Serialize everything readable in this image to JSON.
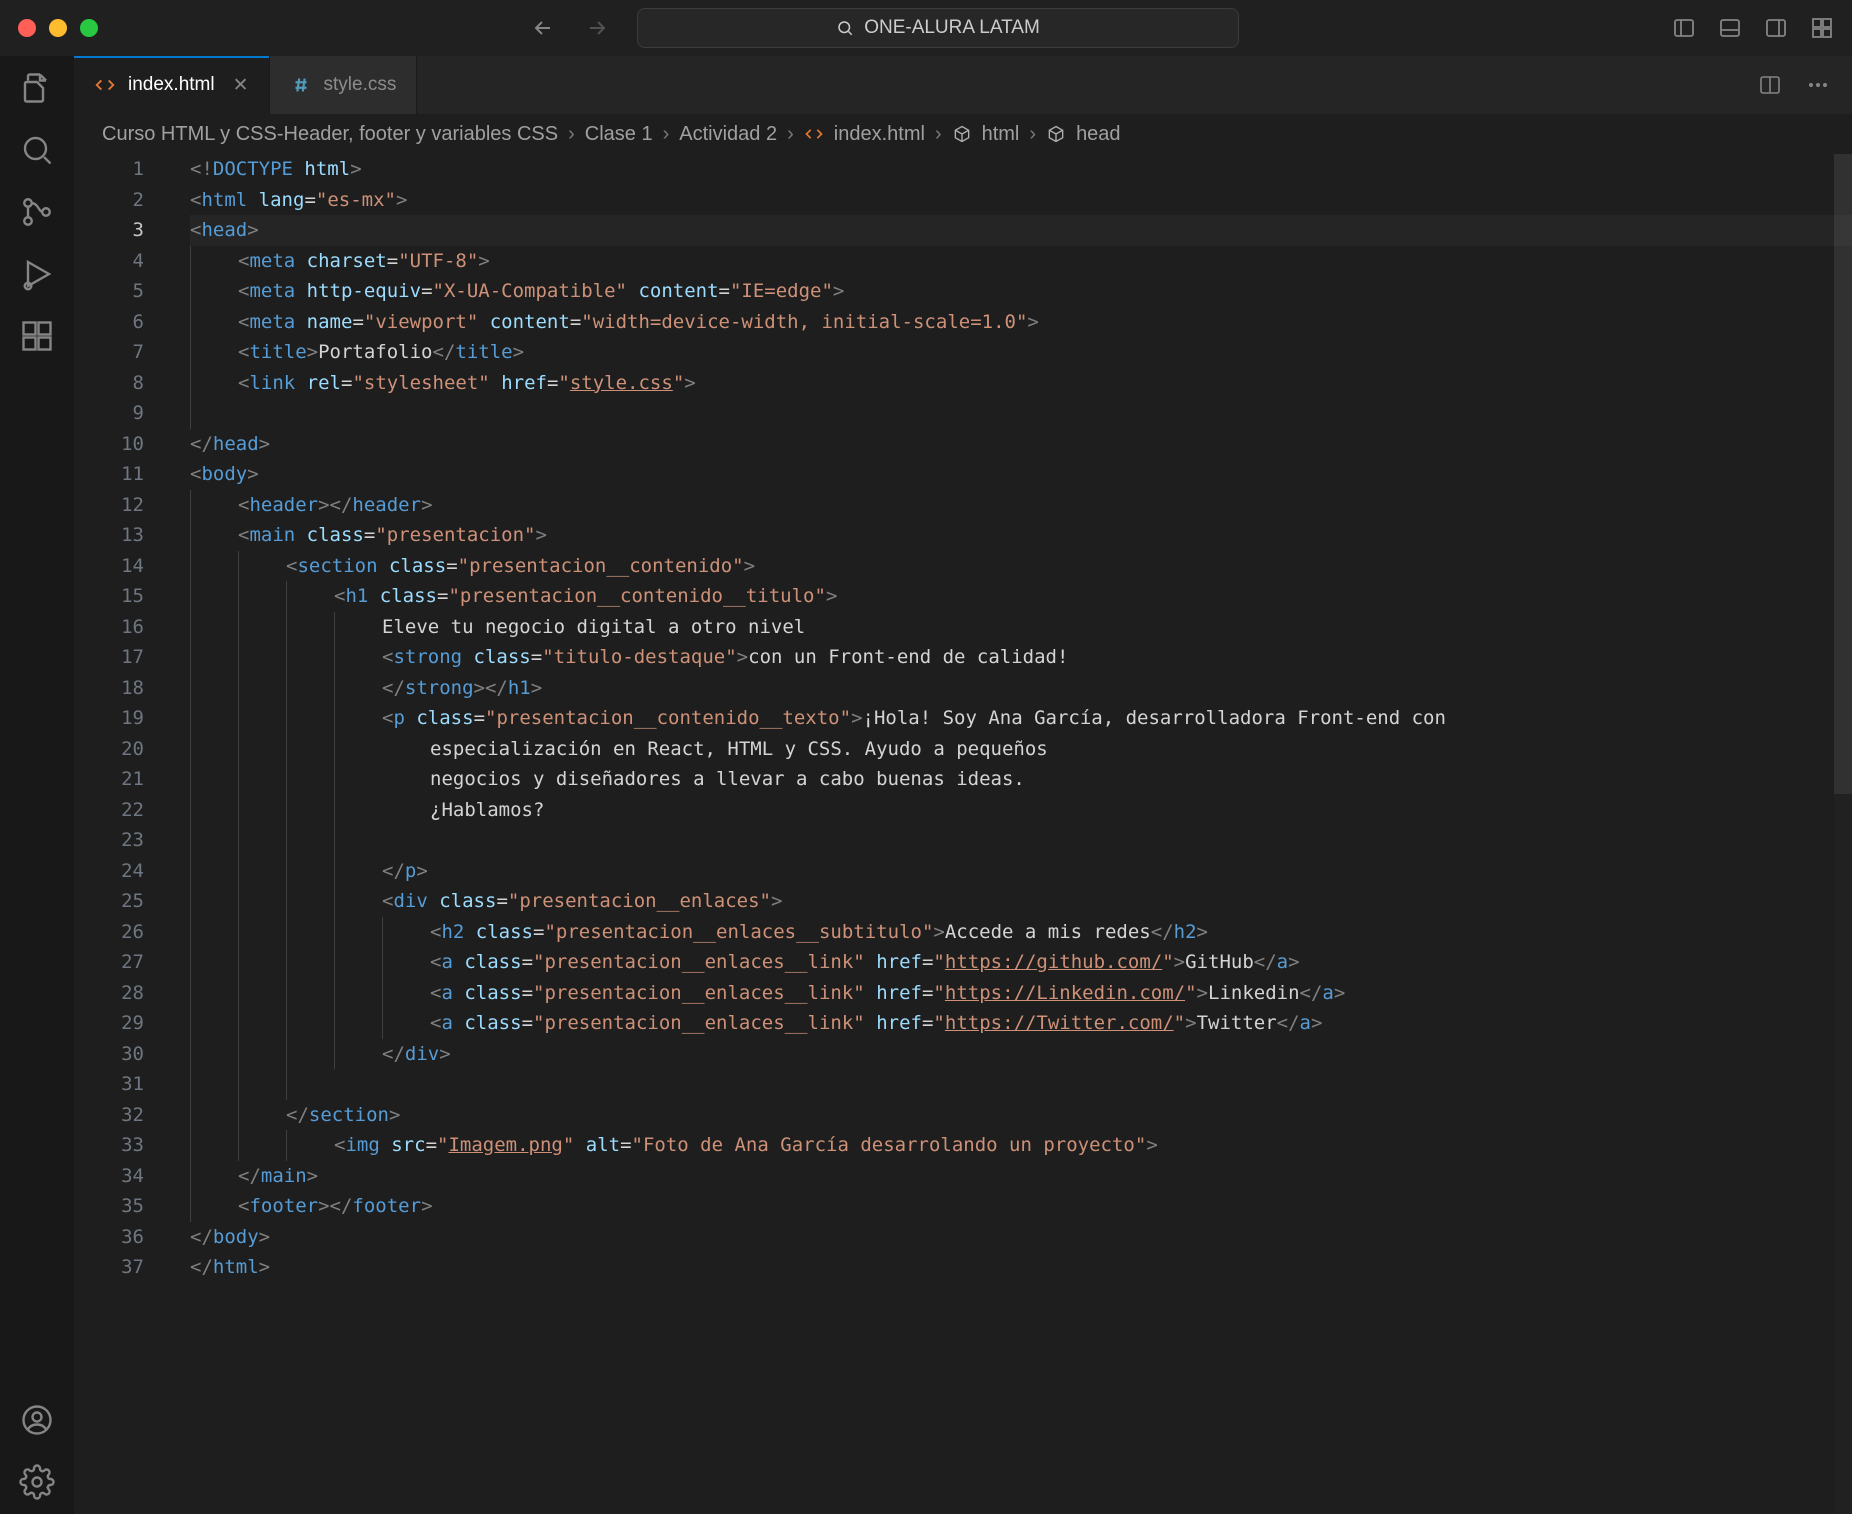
{
  "titlebar": {
    "workspace": "ONE-ALURA LATAM"
  },
  "tabs": [
    {
      "label": "index.html",
      "active": true,
      "kind": "html"
    },
    {
      "label": "style.css",
      "active": false,
      "kind": "css"
    }
  ],
  "breadcrumbs": [
    {
      "label": "Curso HTML y CSS-Header, footer y variables CSS",
      "icon": null
    },
    {
      "label": "Clase 1",
      "icon": null
    },
    {
      "label": "Actividad 2",
      "icon": null
    },
    {
      "label": "index.html",
      "icon": "code"
    },
    {
      "label": "html",
      "icon": "cube"
    },
    {
      "label": "head",
      "icon": "cube"
    }
  ],
  "active_line": 3,
  "line_count": 37,
  "code_tokens": [
    [
      [
        "t-gray",
        "<!"
      ],
      [
        "t-tag",
        "DOCTYPE"
      ],
      [
        "t-txt",
        " "
      ],
      [
        "t-attr",
        "html"
      ],
      [
        "t-gray",
        ">"
      ]
    ],
    [
      [
        "t-gray",
        "<"
      ],
      [
        "t-tag",
        "html"
      ],
      [
        "t-txt",
        " "
      ],
      [
        "t-attr",
        "lang"
      ],
      [
        "t-txt",
        "="
      ],
      [
        "t-str",
        "\"es-mx\""
      ],
      [
        "t-gray",
        ">"
      ]
    ],
    [
      [
        "t-gray",
        "<"
      ],
      [
        "t-tag",
        "head"
      ],
      [
        "t-gray",
        ">"
      ]
    ],
    [
      [
        "indent",
        1
      ],
      [
        "t-gray",
        "<"
      ],
      [
        "t-tag",
        "meta"
      ],
      [
        "t-txt",
        " "
      ],
      [
        "t-attr",
        "charset"
      ],
      [
        "t-txt",
        "="
      ],
      [
        "t-str",
        "\"UTF-8\""
      ],
      [
        "t-gray",
        ">"
      ]
    ],
    [
      [
        "indent",
        1
      ],
      [
        "t-gray",
        "<"
      ],
      [
        "t-tag",
        "meta"
      ],
      [
        "t-txt",
        " "
      ],
      [
        "t-attr",
        "http-equiv"
      ],
      [
        "t-txt",
        "="
      ],
      [
        "t-str",
        "\"X-UA-Compatible\""
      ],
      [
        "t-txt",
        " "
      ],
      [
        "t-attr",
        "content"
      ],
      [
        "t-txt",
        "="
      ],
      [
        "t-str",
        "\"IE=edge\""
      ],
      [
        "t-gray",
        ">"
      ]
    ],
    [
      [
        "indent",
        1
      ],
      [
        "t-gray",
        "<"
      ],
      [
        "t-tag",
        "meta"
      ],
      [
        "t-txt",
        " "
      ],
      [
        "t-attr",
        "name"
      ],
      [
        "t-txt",
        "="
      ],
      [
        "t-str",
        "\"viewport\""
      ],
      [
        "t-txt",
        " "
      ],
      [
        "t-attr",
        "content"
      ],
      [
        "t-txt",
        "="
      ],
      [
        "t-str",
        "\"width=device-width, initial-scale=1.0\""
      ],
      [
        "t-gray",
        ">"
      ]
    ],
    [
      [
        "indent",
        1
      ],
      [
        "t-gray",
        "<"
      ],
      [
        "t-tag",
        "title"
      ],
      [
        "t-gray",
        ">"
      ],
      [
        "t-txt",
        "Portafolio"
      ],
      [
        "t-gray",
        "</"
      ],
      [
        "t-tag",
        "title"
      ],
      [
        "t-gray",
        ">"
      ]
    ],
    [
      [
        "indent",
        1
      ],
      [
        "t-gray",
        "<"
      ],
      [
        "t-tag",
        "link"
      ],
      [
        "t-txt",
        " "
      ],
      [
        "t-attr",
        "rel"
      ],
      [
        "t-txt",
        "="
      ],
      [
        "t-str",
        "\"stylesheet\""
      ],
      [
        "t-txt",
        " "
      ],
      [
        "t-attr",
        "href"
      ],
      [
        "t-txt",
        "="
      ],
      [
        "t-str",
        "\""
      ],
      [
        "t-link",
        "style.css"
      ],
      [
        "t-str",
        "\""
      ],
      [
        "t-gray",
        ">"
      ]
    ],
    [
      [
        "indent",
        1
      ]
    ],
    [
      [
        "t-gray",
        "</"
      ],
      [
        "t-tag",
        "head"
      ],
      [
        "t-gray",
        ">"
      ]
    ],
    [
      [
        "t-gray",
        "<"
      ],
      [
        "t-tag",
        "body"
      ],
      [
        "t-gray",
        ">"
      ]
    ],
    [
      [
        "indent",
        1
      ],
      [
        "t-gray",
        "<"
      ],
      [
        "t-tag",
        "header"
      ],
      [
        "t-gray",
        "></"
      ],
      [
        "t-tag",
        "header"
      ],
      [
        "t-gray",
        ">"
      ]
    ],
    [
      [
        "indent",
        1
      ],
      [
        "t-gray",
        "<"
      ],
      [
        "t-tag",
        "main"
      ],
      [
        "t-txt",
        " "
      ],
      [
        "t-attr",
        "class"
      ],
      [
        "t-txt",
        "="
      ],
      [
        "t-str",
        "\"presentacion\""
      ],
      [
        "t-gray",
        ">"
      ]
    ],
    [
      [
        "indent",
        2
      ],
      [
        "t-gray",
        "<"
      ],
      [
        "t-tag",
        "section"
      ],
      [
        "t-txt",
        " "
      ],
      [
        "t-attr",
        "class"
      ],
      [
        "t-txt",
        "="
      ],
      [
        "t-str",
        "\"presentacion__contenido\""
      ],
      [
        "t-gray",
        ">"
      ]
    ],
    [
      [
        "indent",
        3
      ],
      [
        "t-gray",
        "<"
      ],
      [
        "t-tag",
        "h1"
      ],
      [
        "t-txt",
        " "
      ],
      [
        "t-attr",
        "class"
      ],
      [
        "t-txt",
        "="
      ],
      [
        "t-str",
        "\"presentacion__contenido__titulo\""
      ],
      [
        "t-gray",
        ">"
      ]
    ],
    [
      [
        "indent",
        4
      ],
      [
        "t-txt",
        "Eleve tu negocio digital a otro nivel"
      ]
    ],
    [
      [
        "indent",
        4
      ],
      [
        "t-gray",
        "<"
      ],
      [
        "t-tag",
        "strong"
      ],
      [
        "t-txt",
        " "
      ],
      [
        "t-attr",
        "class"
      ],
      [
        "t-txt",
        "="
      ],
      [
        "t-str",
        "\"titulo-destaque\""
      ],
      [
        "t-gray",
        ">"
      ],
      [
        "t-txt",
        "con un Front-end de calidad!"
      ]
    ],
    [
      [
        "indent",
        4
      ],
      [
        "t-gray",
        "</"
      ],
      [
        "t-tag",
        "strong"
      ],
      [
        "t-gray",
        "></"
      ],
      [
        "t-tag",
        "h1"
      ],
      [
        "t-gray",
        ">"
      ]
    ],
    [
      [
        "indent",
        4
      ],
      [
        "t-gray",
        "<"
      ],
      [
        "t-tag",
        "p"
      ],
      [
        "t-txt",
        " "
      ],
      [
        "t-attr",
        "class"
      ],
      [
        "t-txt",
        "="
      ],
      [
        "t-str",
        "\"presentacion__contenido__texto\""
      ],
      [
        "t-gray",
        ">"
      ],
      [
        "t-txt",
        "¡Hola! Soy Ana García, desarrolladora Front-end con "
      ]
    ],
    [
      [
        "indent",
        4
      ],
      [
        "pad",
        1
      ],
      [
        "t-txt",
        "especialización en React, HTML y CSS. Ayudo a pequeños "
      ]
    ],
    [
      [
        "indent",
        4
      ],
      [
        "pad",
        1
      ],
      [
        "t-txt",
        "negocios y diseñadores a llevar a cabo buenas ideas. "
      ]
    ],
    [
      [
        "indent",
        4
      ],
      [
        "pad",
        1
      ],
      [
        "t-txt",
        "¿Hablamos?"
      ]
    ],
    [
      [
        "indent",
        4
      ],
      [
        "pad",
        1
      ]
    ],
    [
      [
        "indent",
        4
      ],
      [
        "t-gray",
        "</"
      ],
      [
        "t-tag",
        "p"
      ],
      [
        "t-gray",
        ">"
      ]
    ],
    [
      [
        "indent",
        4
      ],
      [
        "t-gray",
        "<"
      ],
      [
        "t-tag",
        "div"
      ],
      [
        "t-txt",
        " "
      ],
      [
        "t-attr",
        "class"
      ],
      [
        "t-txt",
        "="
      ],
      [
        "t-str",
        "\"presentacion__enlaces\""
      ],
      [
        "t-gray",
        ">"
      ]
    ],
    [
      [
        "indent",
        5
      ],
      [
        "t-gray",
        "<"
      ],
      [
        "t-tag",
        "h2"
      ],
      [
        "t-txt",
        " "
      ],
      [
        "t-attr",
        "class"
      ],
      [
        "t-txt",
        "="
      ],
      [
        "t-str",
        "\"presentacion__enlaces__subtitulo\""
      ],
      [
        "t-gray",
        ">"
      ],
      [
        "t-txt",
        "Accede a mis redes"
      ],
      [
        "t-gray",
        "</"
      ],
      [
        "t-tag",
        "h2"
      ],
      [
        "t-gray",
        ">"
      ]
    ],
    [
      [
        "indent",
        5
      ],
      [
        "t-gray",
        "<"
      ],
      [
        "t-tag",
        "a"
      ],
      [
        "t-txt",
        " "
      ],
      [
        "t-attr",
        "class"
      ],
      [
        "t-txt",
        "="
      ],
      [
        "t-str",
        "\"presentacion__enlaces__link\""
      ],
      [
        "t-txt",
        " "
      ],
      [
        "t-attr",
        "href"
      ],
      [
        "t-txt",
        "="
      ],
      [
        "t-str",
        "\""
      ],
      [
        "t-link",
        "https://github.com/"
      ],
      [
        "t-str",
        "\""
      ],
      [
        "t-gray",
        ">"
      ],
      [
        "t-txt",
        "GitHub"
      ],
      [
        "t-gray",
        "</"
      ],
      [
        "t-tag",
        "a"
      ],
      [
        "t-gray",
        ">"
      ]
    ],
    [
      [
        "indent",
        5
      ],
      [
        "t-gray",
        "<"
      ],
      [
        "t-tag",
        "a"
      ],
      [
        "t-txt",
        " "
      ],
      [
        "t-attr",
        "class"
      ],
      [
        "t-txt",
        "="
      ],
      [
        "t-str",
        "\"presentacion__enlaces__link\""
      ],
      [
        "t-txt",
        " "
      ],
      [
        "t-attr",
        "href"
      ],
      [
        "t-txt",
        "="
      ],
      [
        "t-str",
        "\""
      ],
      [
        "t-link",
        "https://Linkedin.com/"
      ],
      [
        "t-str",
        "\""
      ],
      [
        "t-gray",
        ">"
      ],
      [
        "t-txt",
        "Linkedin"
      ],
      [
        "t-gray",
        "</"
      ],
      [
        "t-tag",
        "a"
      ],
      [
        "t-gray",
        ">"
      ]
    ],
    [
      [
        "indent",
        5
      ],
      [
        "t-gray",
        "<"
      ],
      [
        "t-tag",
        "a"
      ],
      [
        "t-txt",
        " "
      ],
      [
        "t-attr",
        "class"
      ],
      [
        "t-txt",
        "="
      ],
      [
        "t-str",
        "\"presentacion__enlaces__link\""
      ],
      [
        "t-txt",
        " "
      ],
      [
        "t-attr",
        "href"
      ],
      [
        "t-txt",
        "="
      ],
      [
        "t-str",
        "\""
      ],
      [
        "t-link",
        "https://Twitter.com/"
      ],
      [
        "t-str",
        "\""
      ],
      [
        "t-gray",
        ">"
      ],
      [
        "t-txt",
        "Twitter"
      ],
      [
        "t-gray",
        "</"
      ],
      [
        "t-tag",
        "a"
      ],
      [
        "t-gray",
        ">"
      ]
    ],
    [
      [
        "indent",
        4
      ],
      [
        "t-gray",
        "</"
      ],
      [
        "t-tag",
        "div"
      ],
      [
        "t-gray",
        ">"
      ]
    ],
    [
      [
        "indent",
        3
      ]
    ],
    [
      [
        "indent",
        2
      ],
      [
        "t-gray",
        "</"
      ],
      [
        "t-tag",
        "section"
      ],
      [
        "t-gray",
        ">"
      ]
    ],
    [
      [
        "indent",
        3
      ],
      [
        "t-gray",
        "<"
      ],
      [
        "t-tag",
        "img"
      ],
      [
        "t-txt",
        " "
      ],
      [
        "t-attr",
        "src"
      ],
      [
        "t-txt",
        "="
      ],
      [
        "t-str",
        "\""
      ],
      [
        "t-link",
        "Imagem.png"
      ],
      [
        "t-str",
        "\""
      ],
      [
        "t-txt",
        " "
      ],
      [
        "t-attr",
        "alt"
      ],
      [
        "t-txt",
        "="
      ],
      [
        "t-str",
        "\"Foto de Ana García desarrolando un proyecto\""
      ],
      [
        "t-gray",
        ">"
      ]
    ],
    [
      [
        "indent",
        1
      ],
      [
        "t-gray",
        "</"
      ],
      [
        "t-tag",
        "main"
      ],
      [
        "t-gray",
        ">"
      ]
    ],
    [
      [
        "indent",
        1
      ],
      [
        "t-gray",
        "<"
      ],
      [
        "t-tag",
        "footer"
      ],
      [
        "t-gray",
        "></"
      ],
      [
        "t-tag",
        "footer"
      ],
      [
        "t-gray",
        ">"
      ]
    ],
    [
      [
        "t-gray",
        "</"
      ],
      [
        "t-tag",
        "body"
      ],
      [
        "t-gray",
        ">"
      ]
    ],
    [
      [
        "t-gray",
        "</"
      ],
      [
        "t-tag",
        "html"
      ],
      [
        "t-gray",
        ">"
      ]
    ]
  ]
}
